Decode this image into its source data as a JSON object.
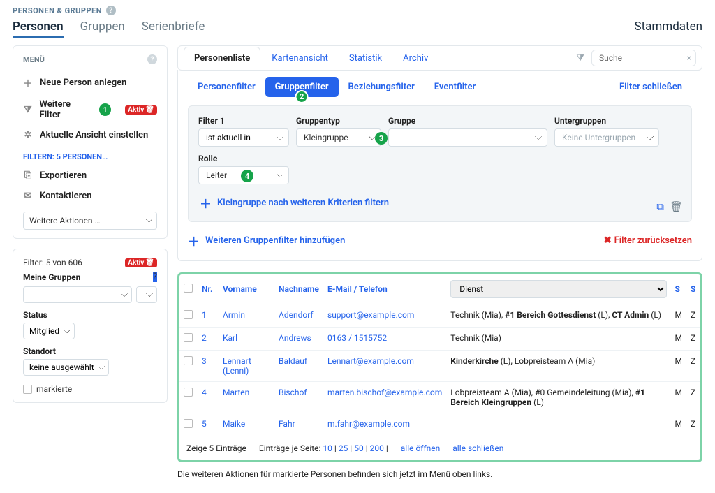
{
  "breadcrumb": "PERSONEN & GRUPPEN",
  "topTabs": {
    "persons": "Personen",
    "groups": "Gruppen",
    "letters": "Serienbriefe",
    "right": "Stammdaten"
  },
  "menu": {
    "title": "MENÜ",
    "newPerson": "Neue Person anlegen",
    "moreFilters": "Weitere Filter",
    "aktiv": "Aktiv",
    "configView": "Aktuelle Ansicht einstellen",
    "filterHeading": "FILTERN: 5 PERSONEN…",
    "export": "Exportieren",
    "contact": "Kontaktieren",
    "moreActions": "Weitere Aktionen …"
  },
  "side2": {
    "summary": "Filter: 5 von 606",
    "aktiv": "Aktiv",
    "myGroups": "Meine Gruppen",
    "status": "Status",
    "statusVal": "Mitglied",
    "location": "Standort",
    "locationVal": "keine ausgewählt",
    "marked": "markierte"
  },
  "tabs2": {
    "list": "Personenliste",
    "map": "Kartenansicht",
    "stats": "Statistik",
    "archive": "Archiv",
    "search": "Suche"
  },
  "ftabs": {
    "pf": "Personenfilter",
    "gf": "Gruppenfilter",
    "bf": "Beziehungsfilter",
    "ef": "Eventfilter",
    "close": "Filter schließen"
  },
  "filter": {
    "f1": "Filter 1",
    "f1v": "ist aktuell in",
    "gtyp": "Gruppentyp",
    "gtypv": "Kleingruppe",
    "grp": "Gruppe",
    "sub": "Untergruppen",
    "subv": "Keine Untergruppen",
    "role": "Rolle",
    "rolev": "Leiter",
    "more": "Kleingruppe nach weiteren Kriterien filtern",
    "add": "Weiteren Gruppenfilter hinzufügen",
    "reset": "Filter zurücksetzen"
  },
  "cols": {
    "nr": "Nr.",
    "vn": "Vorname",
    "nn": "Nachname",
    "em": "E-Mail / Telefon",
    "dienst": "Dienst",
    "s1": "S",
    "s2": "S"
  },
  "rows": [
    {
      "nr": "1",
      "vn": "Armin",
      "nn": "Adendorf",
      "em": "support@example.com",
      "d": "Technik (Mia), <b>#1 Bereich Gottesdienst</b> (L), <b>CT Admin</b> (L)",
      "m": "M",
      "z": "Z"
    },
    {
      "nr": "2",
      "vn": "Karl",
      "nn": "Andrews",
      "em": "0163 / 1515752",
      "d": "Technik (Mia)",
      "m": "M",
      "z": "Z"
    },
    {
      "nr": "3",
      "vn": "Lennart (Lenni)",
      "nn": "Baldauf",
      "em": "Lennart@example.com",
      "d": "<b>Kinderkirche</b> (L), Lobpreisteam A (Mia)",
      "m": "M",
      "z": "Z"
    },
    {
      "nr": "4",
      "vn": "Marten",
      "nn": "Bischof",
      "em": "marten.bischof@example.com",
      "d": "Lobpreisteam A (Mia), #0 Gemeindeleitung (Mia), <b>#1 Bereich Kleingruppen</b> (L)",
      "m": "M",
      "z": "Z"
    },
    {
      "nr": "5",
      "vn": "Maike",
      "nn": "Fahr",
      "em": "m.fahr@example.com",
      "d": "",
      "m": "M",
      "z": "Z"
    }
  ],
  "foot": {
    "show": "Zeige 5 Einträge",
    "perpage": "Einträge je Seite:",
    "p10": "10",
    "p25": "25",
    "p50": "50",
    "p200": "200",
    "open": "alle öffnen",
    "close": "alle schließen"
  },
  "hint": "Die weiteren Aktionen für markierte Personen befinden sich jetzt im Menü oben links."
}
